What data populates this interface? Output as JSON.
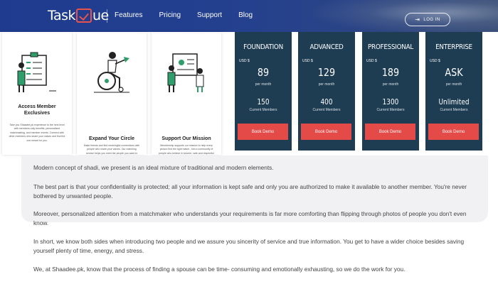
{
  "nav": {
    "logo_prefix": "Task",
    "logo_suffix": "ue",
    "links": [
      "Features",
      "Pricing",
      "Support",
      "Blog"
    ],
    "login_label": "LOG IN",
    "login_icon": "login-arrow-icon",
    "brand_color": "#1f3b8f",
    "accent_color": "#e8534d"
  },
  "features": [
    {
      "icon": "clipboard-person-illustration",
      "title": "Access Member Exclusives",
      "desc": "Take you Shaadee.pk experience to the next level with members-only benefits, personalized matchmaking, and member events. Connect with other members who share your values and find the one meant for you."
    },
    {
      "icon": "wheelchair-person-illustration",
      "title": "Expand Your Circle",
      "desc": "Make friends and find meaningful connections with people who share your values. Our matching service helps you meet the people you want to know, from every background and community across the country."
    },
    {
      "icon": "people-screen-illustration",
      "title": "Support Our Mission",
      "desc": "Membership supports our mission to help every person find the right match. Join a community of people who believe in sincere, safe and respectful introductions and help us reach more families."
    }
  ],
  "plans": [
    {
      "name": "FOUNDATION",
      "currency": "USD $",
      "price": "89",
      "period": "per month",
      "members": "150",
      "members_label": "Current Members",
      "cta": "Book Demo"
    },
    {
      "name": "ADVANCED",
      "currency": "USD $",
      "price": "129",
      "period": "per month",
      "members": "400",
      "members_label": "Current Members",
      "cta": "Book Demo"
    },
    {
      "name": "PROFESSIONAL",
      "currency": "USD $",
      "price": "189",
      "period": "per month",
      "members": "1300",
      "members_label": "Current Members",
      "cta": "Book Demo"
    },
    {
      "name": "ENTERPRISE",
      "currency": "USD $",
      "price": "ASK",
      "period": "per month",
      "members": "Unlimited",
      "members_label": "Current Members",
      "cta": "Book Demo"
    }
  ],
  "plan_colors": {
    "card": "#1e3c52",
    "button": "#e44a48"
  },
  "content": {
    "paragraphs": [
      "Modern concept of shadi, we present is an ideal mixture of traditional and modern elements.",
      "The best part is that your confidentiality is protected; all your information is kept safe and only you are authorized to make it available to another member. You're never bothered by unwanted people.",
      "Moreover, personalized attention from a matchmaker who understands your requirements is far more comforting than flipping through photos of people you don't even know.",
      "In short, we know both sides when introducing two people and we assure you sincerity of service and true information. You get to have a wider choice besides saving yourself plenty of time, energy, and stress.",
      "We, at Shaadee.pk, know that the process of finding a spouse can be time- consuming and emotionally exhausting, so we do the work for you."
    ]
  }
}
